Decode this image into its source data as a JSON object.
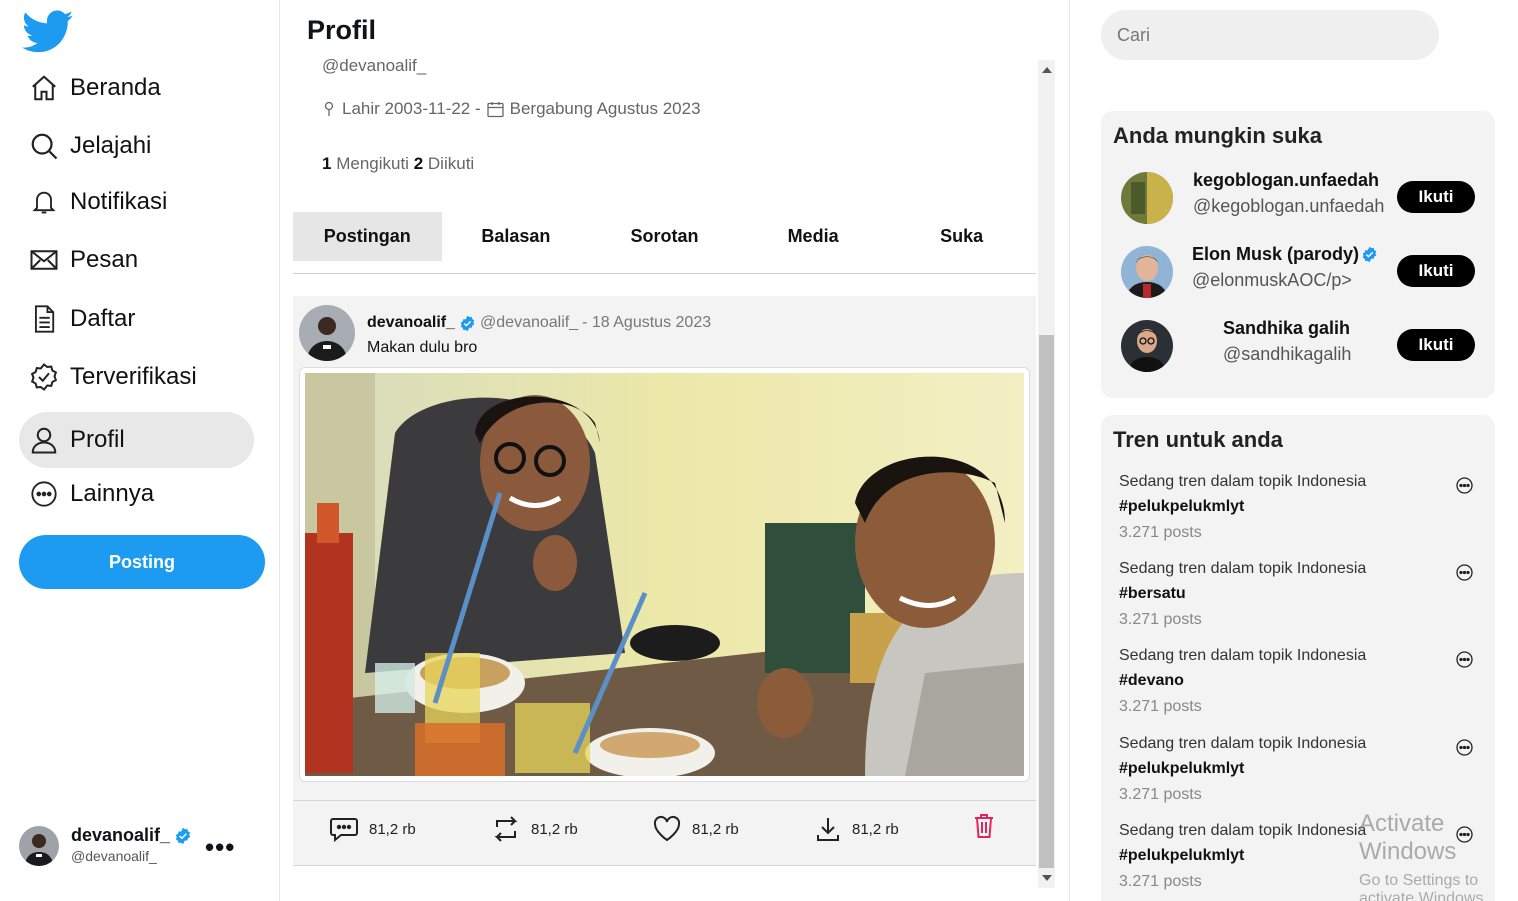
{
  "sidebar": {
    "items": [
      {
        "label": "Beranda",
        "icon": "home-icon"
      },
      {
        "label": "Jelajahi",
        "icon": "search-icon"
      },
      {
        "label": "Notifikasi",
        "icon": "bell-icon"
      },
      {
        "label": "Pesan",
        "icon": "mail-icon"
      },
      {
        "label": "Daftar",
        "icon": "list-icon"
      },
      {
        "label": "Terverifikasi",
        "icon": "verified-icon"
      },
      {
        "label": "Profil",
        "icon": "user-icon"
      },
      {
        "label": "Lainnya",
        "icon": "more-circle-icon"
      }
    ],
    "active_item": "Profil",
    "post_button": "Posting",
    "account": {
      "name": "devanoalif_",
      "handle": "@devanoalif_"
    }
  },
  "profile": {
    "title": "Profil",
    "handle": "@devanoalif_",
    "birth": "Lahir 2003-11-22 -",
    "joined": "Bergabung Agustus 2023",
    "following_count": "1",
    "following_label": "Mengikuti",
    "followers_count": "2",
    "followers_label": "Diikuti",
    "tabs": [
      "Postingan",
      "Balasan",
      "Sorotan",
      "Media",
      "Suka"
    ],
    "active_tab": "Postingan"
  },
  "post": {
    "name": "devanoalif_",
    "handle": "@devanoalif_",
    "date": "- 18 Agustus 2023",
    "text": "Makan dulu bro",
    "actions": {
      "reply": "81,2 rb",
      "repost": "81,2 rb",
      "like": "81,2 rb",
      "download": "81,2 rb"
    }
  },
  "search": {
    "placeholder": "Cari"
  },
  "suggestions": {
    "title": "Anda mungkin suka",
    "follow_label": "Ikuti",
    "items": [
      {
        "name": "kegoblogan.unfaedah",
        "handle": "@kegoblogan.unfaedah"
      },
      {
        "name": "Elon Musk (parody)",
        "handle": "@elonmuskAOC/p>"
      },
      {
        "name": "Sandhika galih",
        "handle": "@sandhikagalih"
      }
    ]
  },
  "trends": {
    "title": "Tren untuk anda",
    "items": [
      {
        "context": "Sedang tren dalam topik Indonesia",
        "tag": "#pelukpelukmlyt",
        "count": "3.271 posts"
      },
      {
        "context": "Sedang tren dalam topik Indonesia",
        "tag": "#bersatu",
        "count": "3.271 posts"
      },
      {
        "context": "Sedang tren dalam topik Indonesia",
        "tag": "#devano",
        "count": "3.271 posts"
      },
      {
        "context": "Sedang tren dalam topik Indonesia",
        "tag": "#pelukpelukmlyt",
        "count": "3.271 posts"
      },
      {
        "context": "Sedang tren dalam topik Indonesia",
        "tag": "#pelukpelukmlyt",
        "count": "3.271 posts"
      }
    ]
  },
  "watermark": {
    "line1": "Activate Windows",
    "line2": "Go to Settings to activate Windows."
  },
  "colors": {
    "accent": "#1d9bf0",
    "delete": "#e0245e",
    "verified": "#1d9bf0"
  }
}
